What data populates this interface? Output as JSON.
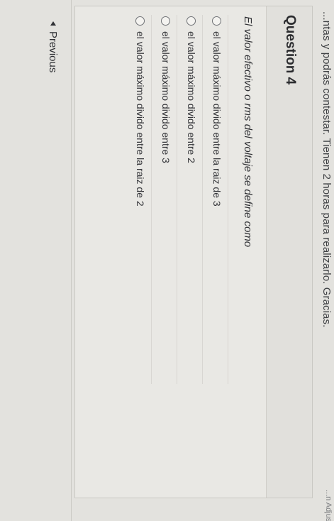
{
  "notice": "...ntas y podrás contestar. Tienen 2 horas para realizarlo. Gracias.",
  "top_right_note": "...n Adjust Fra...",
  "question": {
    "title": "Question 4",
    "text": "El valor efectivo o rms del voltaje se define como",
    "options": [
      {
        "label": "el valor máximo divido entre la raiz de 3",
        "selected": false
      },
      {
        "label": "el valor máximo divido entre 2",
        "selected": false
      },
      {
        "label": "el valor máximo divido entre 3",
        "selected": false
      },
      {
        "label": "el valor máximo divido entre la raiz de 2",
        "selected": false
      }
    ]
  },
  "navigation": {
    "previous_label": "Previous"
  }
}
